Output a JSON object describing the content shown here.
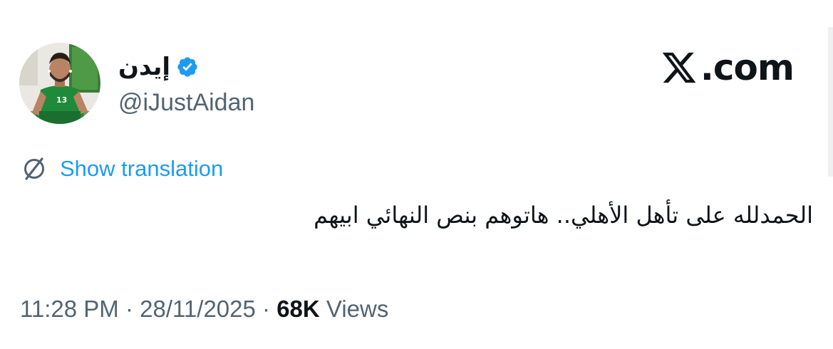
{
  "site": {
    "brand_text": ".com",
    "logo_icon": "x-logo-icon"
  },
  "author": {
    "display_name": "إيدن",
    "handle": "@iJustAidan",
    "verified": true,
    "verified_color": "#1d9bf0",
    "jersey_number": "13"
  },
  "translation": {
    "label": "Show translation",
    "link_color": "#1d9bf0",
    "icon": "translate-icon"
  },
  "tweet": {
    "text": "الحمدلله على تأهل الأهلي.. هاتوهم بنص النهائي ابيهم"
  },
  "meta": {
    "time": "11:28 PM",
    "separator": " · ",
    "date": "28/11/2025",
    "views_count": "68K",
    "views_label": "Views",
    "muted_color": "#536471"
  }
}
